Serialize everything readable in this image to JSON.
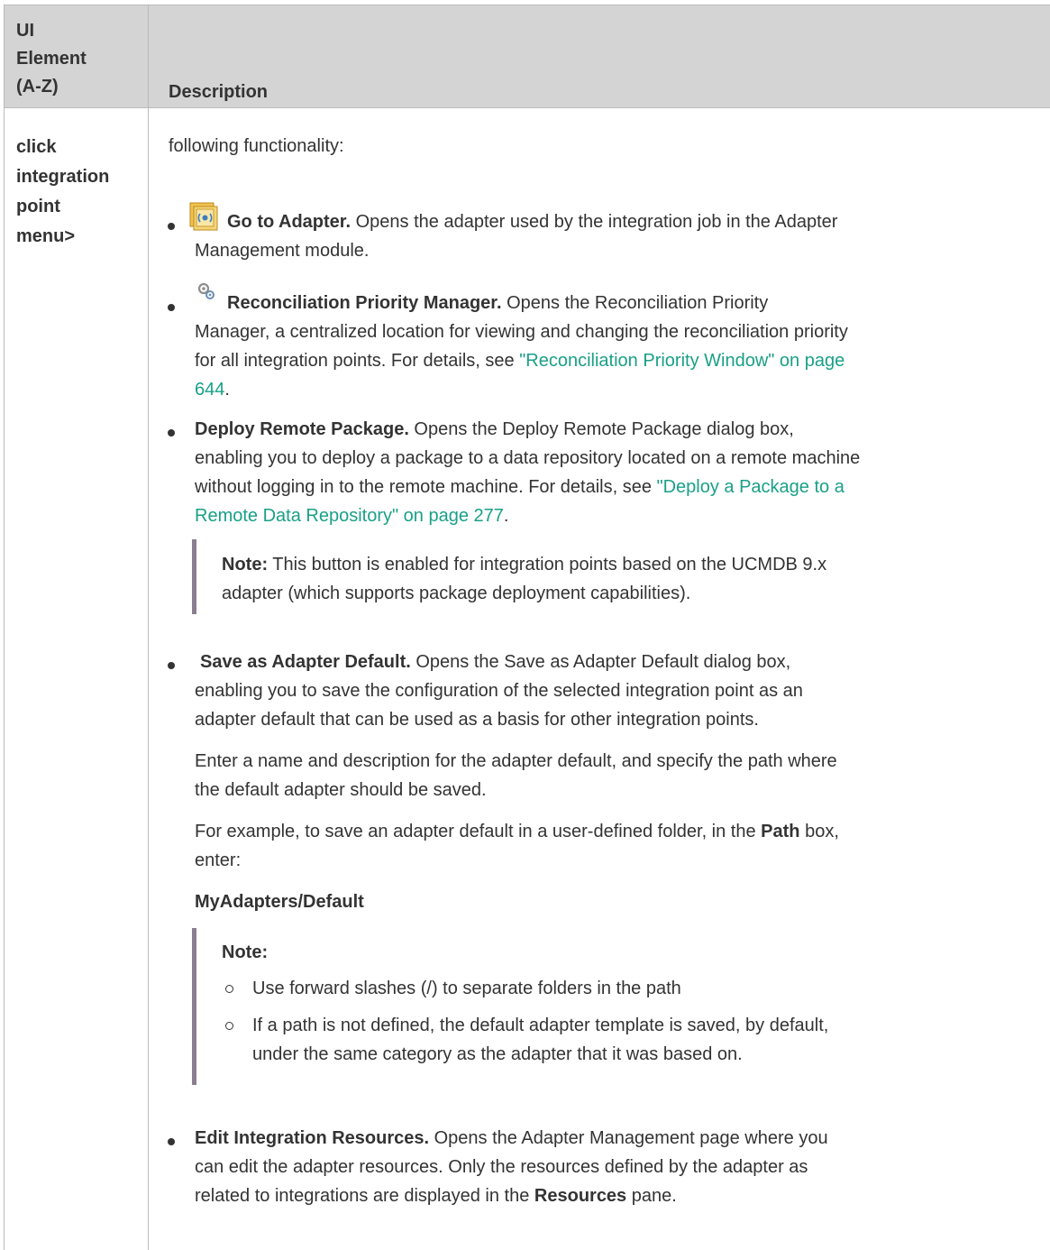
{
  "table": {
    "headers": {
      "element_col": [
        "UI",
        "Element",
        "(A-Z)"
      ],
      "description_col": "Description"
    },
    "row": {
      "element_lines": [
        "click",
        "integration",
        "point",
        "menu>"
      ],
      "intro": "following functionality:",
      "items": [
        {
          "icon": "adapter-icon",
          "title": "Go to Adapter.",
          "text_lines": [
            " Opens the adapter used by the integration job in the Adapter",
            "Management module."
          ]
        },
        {
          "icon": "reconciliation-priority-icon",
          "title": "Reconciliation Priority Manager.",
          "text_lines": [
            " Opens the Reconciliation Priority",
            "Manager, a centralized location for viewing and changing the reconciliation priority",
            "for all integration points. For details, see "
          ],
          "link_lines": [
            "\"Reconciliation Priority Window\" on page",
            "644"
          ],
          "tail": "."
        },
        {
          "title": "Deploy Remote Package.",
          "text_lines": [
            " Opens the Deploy Remote Package dialog box,",
            "enabling you to deploy a package to a data repository located on a remote machine",
            "without logging in to the remote machine. For details, see "
          ],
          "link_lines": [
            "\"Deploy a Package to a",
            "Remote Data Repository\" on page 277"
          ],
          "tail": ".",
          "note": {
            "label": "Note:",
            "lines": [
              " This button is enabled for integration points based on the UCMDB 9.x",
              "adapter (which supports package deployment capabilities)."
            ]
          }
        },
        {
          "title": "Save as Adapter Default.",
          "text_lines": [
            " Opens the Save as Adapter Default dialog box,",
            "enabling you to save the configuration of the selected integration point as an",
            "adapter default that can be used as a basis for other integration points."
          ],
          "para2_lines": [
            "Enter a name and description for the adapter default, and specify the path where",
            "the default adapter should be saved."
          ],
          "para3": {
            "before": "For example, to save an adapter default in a user-defined folder, in the ",
            "bold": "Path",
            "after": " box,",
            "line2": "enter:"
          },
          "path_example": "MyAdapters/Default",
          "note": {
            "label": "Note:",
            "bullets": [
              "Use forward slashes (/) to separate folders in the path",
              "If a path is not defined, the default adapter template is saved, by default,",
              "under the same category as the adapter that it was based on."
            ]
          }
        },
        {
          "title": "Edit Integration Resources.",
          "text_lines": [
            " Opens the Adapter Management page where you",
            "can edit the adapter resources. Only the resources defined by the adapter as",
            "related to integrations are displayed in the "
          ],
          "bold_end": "Resources",
          "tail": " pane."
        }
      ]
    }
  },
  "colors": {
    "link": "#1aa087",
    "header_bg": "#d4d4d4",
    "note_bar": "#8a7e90",
    "text": "#333333"
  }
}
